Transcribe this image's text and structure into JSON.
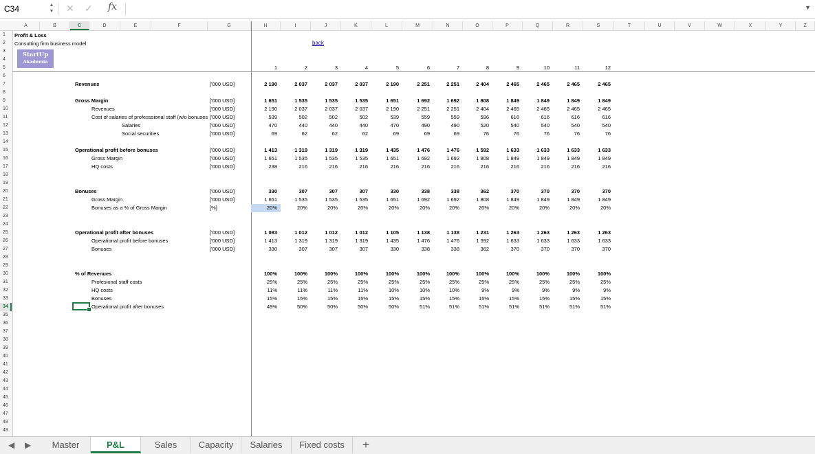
{
  "formula_bar": {
    "cell_ref": "C34",
    "fx": "fx",
    "cancel": "✕",
    "enter": "✓",
    "formula": ""
  },
  "columns": [
    "A",
    "B",
    "C",
    "D",
    "E",
    "F",
    "G",
    "H",
    "I",
    "J",
    "K",
    "L",
    "M",
    "N",
    "O",
    "P",
    "Q",
    "R",
    "S",
    "T",
    "U",
    "V",
    "W",
    "X",
    "Y",
    "Z"
  ],
  "selected_column": "C",
  "selected_row": 34,
  "title": "Profit & Loss",
  "subtitle": "Consulting firm business model",
  "logo": {
    "line1": "StartUp",
    "line2": "Akademia"
  },
  "back_link": "back",
  "periods": [
    "1",
    "2",
    "3",
    "4",
    "5",
    "6",
    "7",
    "8",
    "9",
    "10",
    "11",
    "12"
  ],
  "rows": [
    {
      "row": 7,
      "label": "Revenues",
      "bold": true,
      "indent": 0,
      "unit": "['000 USD]",
      "values": [
        "2 190",
        "2 037",
        "2 037",
        "2 037",
        "2 190",
        "2 251",
        "2 251",
        "2 404",
        "2 465",
        "2 465",
        "2 465",
        "2 465"
      ]
    },
    {
      "row": 9,
      "label": "Gross Margin",
      "bold": true,
      "indent": 0,
      "unit": "['000 USD]",
      "values": [
        "1 651",
        "1 535",
        "1 535",
        "1 535",
        "1 651",
        "1 692",
        "1 692",
        "1 808",
        "1 849",
        "1 849",
        "1 849",
        "1 849"
      ]
    },
    {
      "row": 10,
      "label": "Revenues",
      "bold": false,
      "indent": 1,
      "unit": "['000 USD]",
      "values": [
        "2 190",
        "2 037",
        "2 037",
        "2 037",
        "2 190",
        "2 251",
        "2 251",
        "2 404",
        "2 465",
        "2 465",
        "2 465",
        "2 465"
      ]
    },
    {
      "row": 11,
      "label": "Cost of salaries of professsional staff (w/o bonuses)",
      "bold": false,
      "indent": 1,
      "unit": "['000 USD]",
      "values": [
        "539",
        "502",
        "502",
        "502",
        "539",
        "559",
        "559",
        "596",
        "616",
        "616",
        "616",
        "616"
      ]
    },
    {
      "row": 12,
      "label": "Salaries",
      "bold": false,
      "indent": 2,
      "unit": "['000 USD]",
      "values": [
        "470",
        "440",
        "440",
        "440",
        "470",
        "490",
        "490",
        "520",
        "540",
        "540",
        "540",
        "540"
      ]
    },
    {
      "row": 13,
      "label": "Social securities",
      "bold": false,
      "indent": 2,
      "unit": "['000 USD]",
      "values": [
        "69",
        "62",
        "62",
        "62",
        "69",
        "69",
        "69",
        "76",
        "76",
        "76",
        "76",
        "76"
      ]
    },
    {
      "row": 15,
      "label": "Operational profit before bonuses",
      "bold": true,
      "indent": 0,
      "unit": "['000 USD]",
      "values": [
        "1 413",
        "1 319",
        "1 319",
        "1 319",
        "1 435",
        "1 476",
        "1 476",
        "1 592",
        "1 633",
        "1 633",
        "1 633",
        "1 633"
      ]
    },
    {
      "row": 16,
      "label": "Gross Margin",
      "bold": false,
      "indent": 1,
      "unit": "['000 USD]",
      "values": [
        "1 651",
        "1 535",
        "1 535",
        "1 535",
        "1 651",
        "1 692",
        "1 692",
        "1 808",
        "1 849",
        "1 849",
        "1 849",
        "1 849"
      ]
    },
    {
      "row": 17,
      "label": "HQ costs",
      "bold": false,
      "indent": 1,
      "unit": "['000 USD]",
      "values": [
        "238",
        "216",
        "216",
        "216",
        "216",
        "216",
        "216",
        "216",
        "216",
        "216",
        "216",
        "216"
      ]
    },
    {
      "row": 20,
      "label": "Bonuses",
      "bold": true,
      "indent": 0,
      "unit": "['000 USD]",
      "values": [
        "330",
        "307",
        "307",
        "307",
        "330",
        "338",
        "338",
        "362",
        "370",
        "370",
        "370",
        "370"
      ]
    },
    {
      "row": 21,
      "label": "Gross Margin",
      "bold": false,
      "indent": 1,
      "unit": "['000 USD]",
      "values": [
        "1 651",
        "1 535",
        "1 535",
        "1 535",
        "1 651",
        "1 692",
        "1 692",
        "1 808",
        "1 849",
        "1 849",
        "1 849",
        "1 849"
      ]
    },
    {
      "row": 22,
      "label": "Bonuses as a % of Gross Margin",
      "bold": false,
      "indent": 1,
      "unit": "[%]",
      "values": [
        "20%",
        "20%",
        "20%",
        "20%",
        "20%",
        "20%",
        "20%",
        "20%",
        "20%",
        "20%",
        "20%",
        "20%"
      ]
    },
    {
      "row": 25,
      "label": "Operational profit after bonuses",
      "bold": true,
      "indent": 0,
      "unit": "['000 USD]",
      "values": [
        "1 083",
        "1 012",
        "1 012",
        "1 012",
        "1 105",
        "1 138",
        "1 138",
        "1 231",
        "1 263",
        "1 263",
        "1 263",
        "1 263"
      ]
    },
    {
      "row": 26,
      "label": "Operational profit before bonuses",
      "bold": false,
      "indent": 1,
      "unit": "['000 USD]",
      "values": [
        "1 413",
        "1 319",
        "1 319",
        "1 319",
        "1 435",
        "1 476",
        "1 476",
        "1 592",
        "1 633",
        "1 633",
        "1 633",
        "1 633"
      ]
    },
    {
      "row": 27,
      "label": "Bonuses",
      "bold": false,
      "indent": 1,
      "unit": "['000 USD]",
      "values": [
        "330",
        "307",
        "307",
        "307",
        "330",
        "338",
        "338",
        "362",
        "370",
        "370",
        "370",
        "370"
      ]
    },
    {
      "row": 30,
      "label": "% of Revenues",
      "bold": true,
      "indent": 0,
      "unit": "",
      "values": [
        "100%",
        "100%",
        "100%",
        "100%",
        "100%",
        "100%",
        "100%",
        "100%",
        "100%",
        "100%",
        "100%",
        "100%"
      ]
    },
    {
      "row": 31,
      "label": "Profesional staff costs",
      "bold": false,
      "indent": 1,
      "unit": "",
      "values": [
        "25%",
        "25%",
        "25%",
        "25%",
        "25%",
        "25%",
        "25%",
        "25%",
        "25%",
        "25%",
        "25%",
        "25%"
      ]
    },
    {
      "row": 32,
      "label": "HQ costs",
      "bold": false,
      "indent": 1,
      "unit": "",
      "values": [
        "11%",
        "11%",
        "11%",
        "11%",
        "10%",
        "10%",
        "10%",
        "9%",
        "9%",
        "9%",
        "9%",
        "9%"
      ]
    },
    {
      "row": 33,
      "label": "Bonuses",
      "bold": false,
      "indent": 1,
      "unit": "",
      "values": [
        "15%",
        "15%",
        "15%",
        "15%",
        "15%",
        "15%",
        "15%",
        "15%",
        "15%",
        "15%",
        "15%",
        "15%"
      ]
    },
    {
      "row": 34,
      "label": "Operational profit after bonuses",
      "bold": false,
      "indent": 1,
      "unit": "",
      "values": [
        "49%",
        "50%",
        "50%",
        "50%",
        "50%",
        "51%",
        "51%",
        "51%",
        "51%",
        "51%",
        "51%",
        "51%"
      ]
    }
  ],
  "sheet_tabs": [
    {
      "label": "Master",
      "active": false
    },
    {
      "label": "P&L",
      "active": true
    },
    {
      "label": "Sales",
      "active": false
    },
    {
      "label": "Capacity",
      "active": false
    },
    {
      "label": "Salaries",
      "active": false
    },
    {
      "label": "Fixed costs",
      "active": false
    }
  ],
  "add_sheet": "+",
  "icons": [
    "spin-arrows-icon",
    "cancel-icon",
    "enter-icon",
    "function-icon",
    "expand-formula-icon",
    "tab-prev-icon",
    "tab-next-icon",
    "add-sheet-icon"
  ]
}
